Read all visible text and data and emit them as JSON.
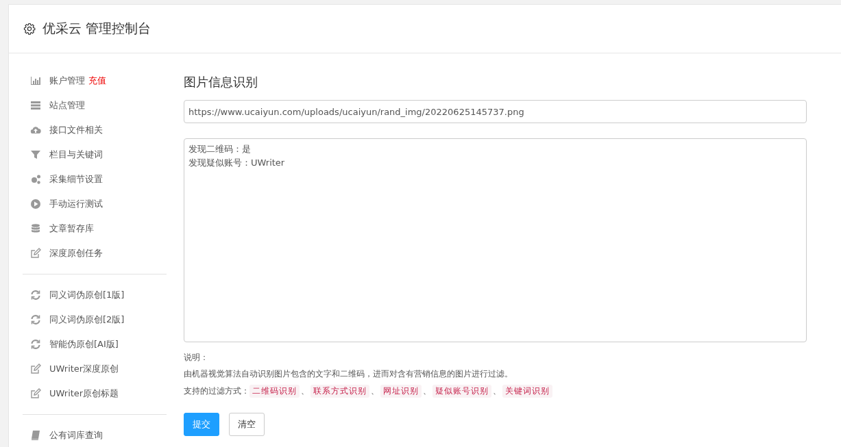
{
  "header": {
    "title": "优采云 管理控制台"
  },
  "sidebar": {
    "groups": [
      {
        "items": [
          {
            "label": "账户管理",
            "badge": "充值",
            "kind": "bars"
          },
          {
            "label": "站点管理",
            "kind": "server"
          },
          {
            "label": "接口文件相关",
            "kind": "cloud"
          },
          {
            "label": "栏目与关键词",
            "kind": "filter"
          },
          {
            "label": "采集细节设置",
            "kind": "gears"
          },
          {
            "label": "手动运行测试",
            "kind": "play"
          },
          {
            "label": "文章暂存库",
            "kind": "database"
          },
          {
            "label": "深度原创任务",
            "kind": "edit"
          }
        ]
      },
      {
        "items": [
          {
            "label": "同义词伪原创[1版]",
            "kind": "refresh"
          },
          {
            "label": "同义词伪原创[2版]",
            "kind": "refresh"
          },
          {
            "label": "智能伪原创[AI版]",
            "kind": "refresh"
          },
          {
            "label": "UWriter深度原创",
            "kind": "edit"
          },
          {
            "label": "UWriter原创标题",
            "kind": "edit"
          }
        ]
      },
      {
        "items": [
          {
            "label": "公有词库查询",
            "kind": "book"
          }
        ]
      }
    ]
  },
  "main": {
    "heading": "图片信息识别",
    "url": "https://www.ucaiyun.com/uploads/ucaiyun/rand_img/20220625145737.png",
    "result_lines": [
      "发现二维码：是",
      "发现疑似账号：UWriter"
    ],
    "note_title": "说明：",
    "note_text": "由机器视觉算法自动识别图片包含的文字和二维码，进而对含有营销信息的图片进行过滤。",
    "filters_label": "支持的过滤方式：",
    "separator": "、",
    "filters": [
      "二维码识别",
      "联系方式识别",
      "网址识别",
      "疑似账号识别",
      "关键词识别"
    ],
    "buttons": [
      {
        "label": "提交",
        "kind": "primary"
      },
      {
        "label": "清空",
        "kind": "default"
      }
    ]
  }
}
